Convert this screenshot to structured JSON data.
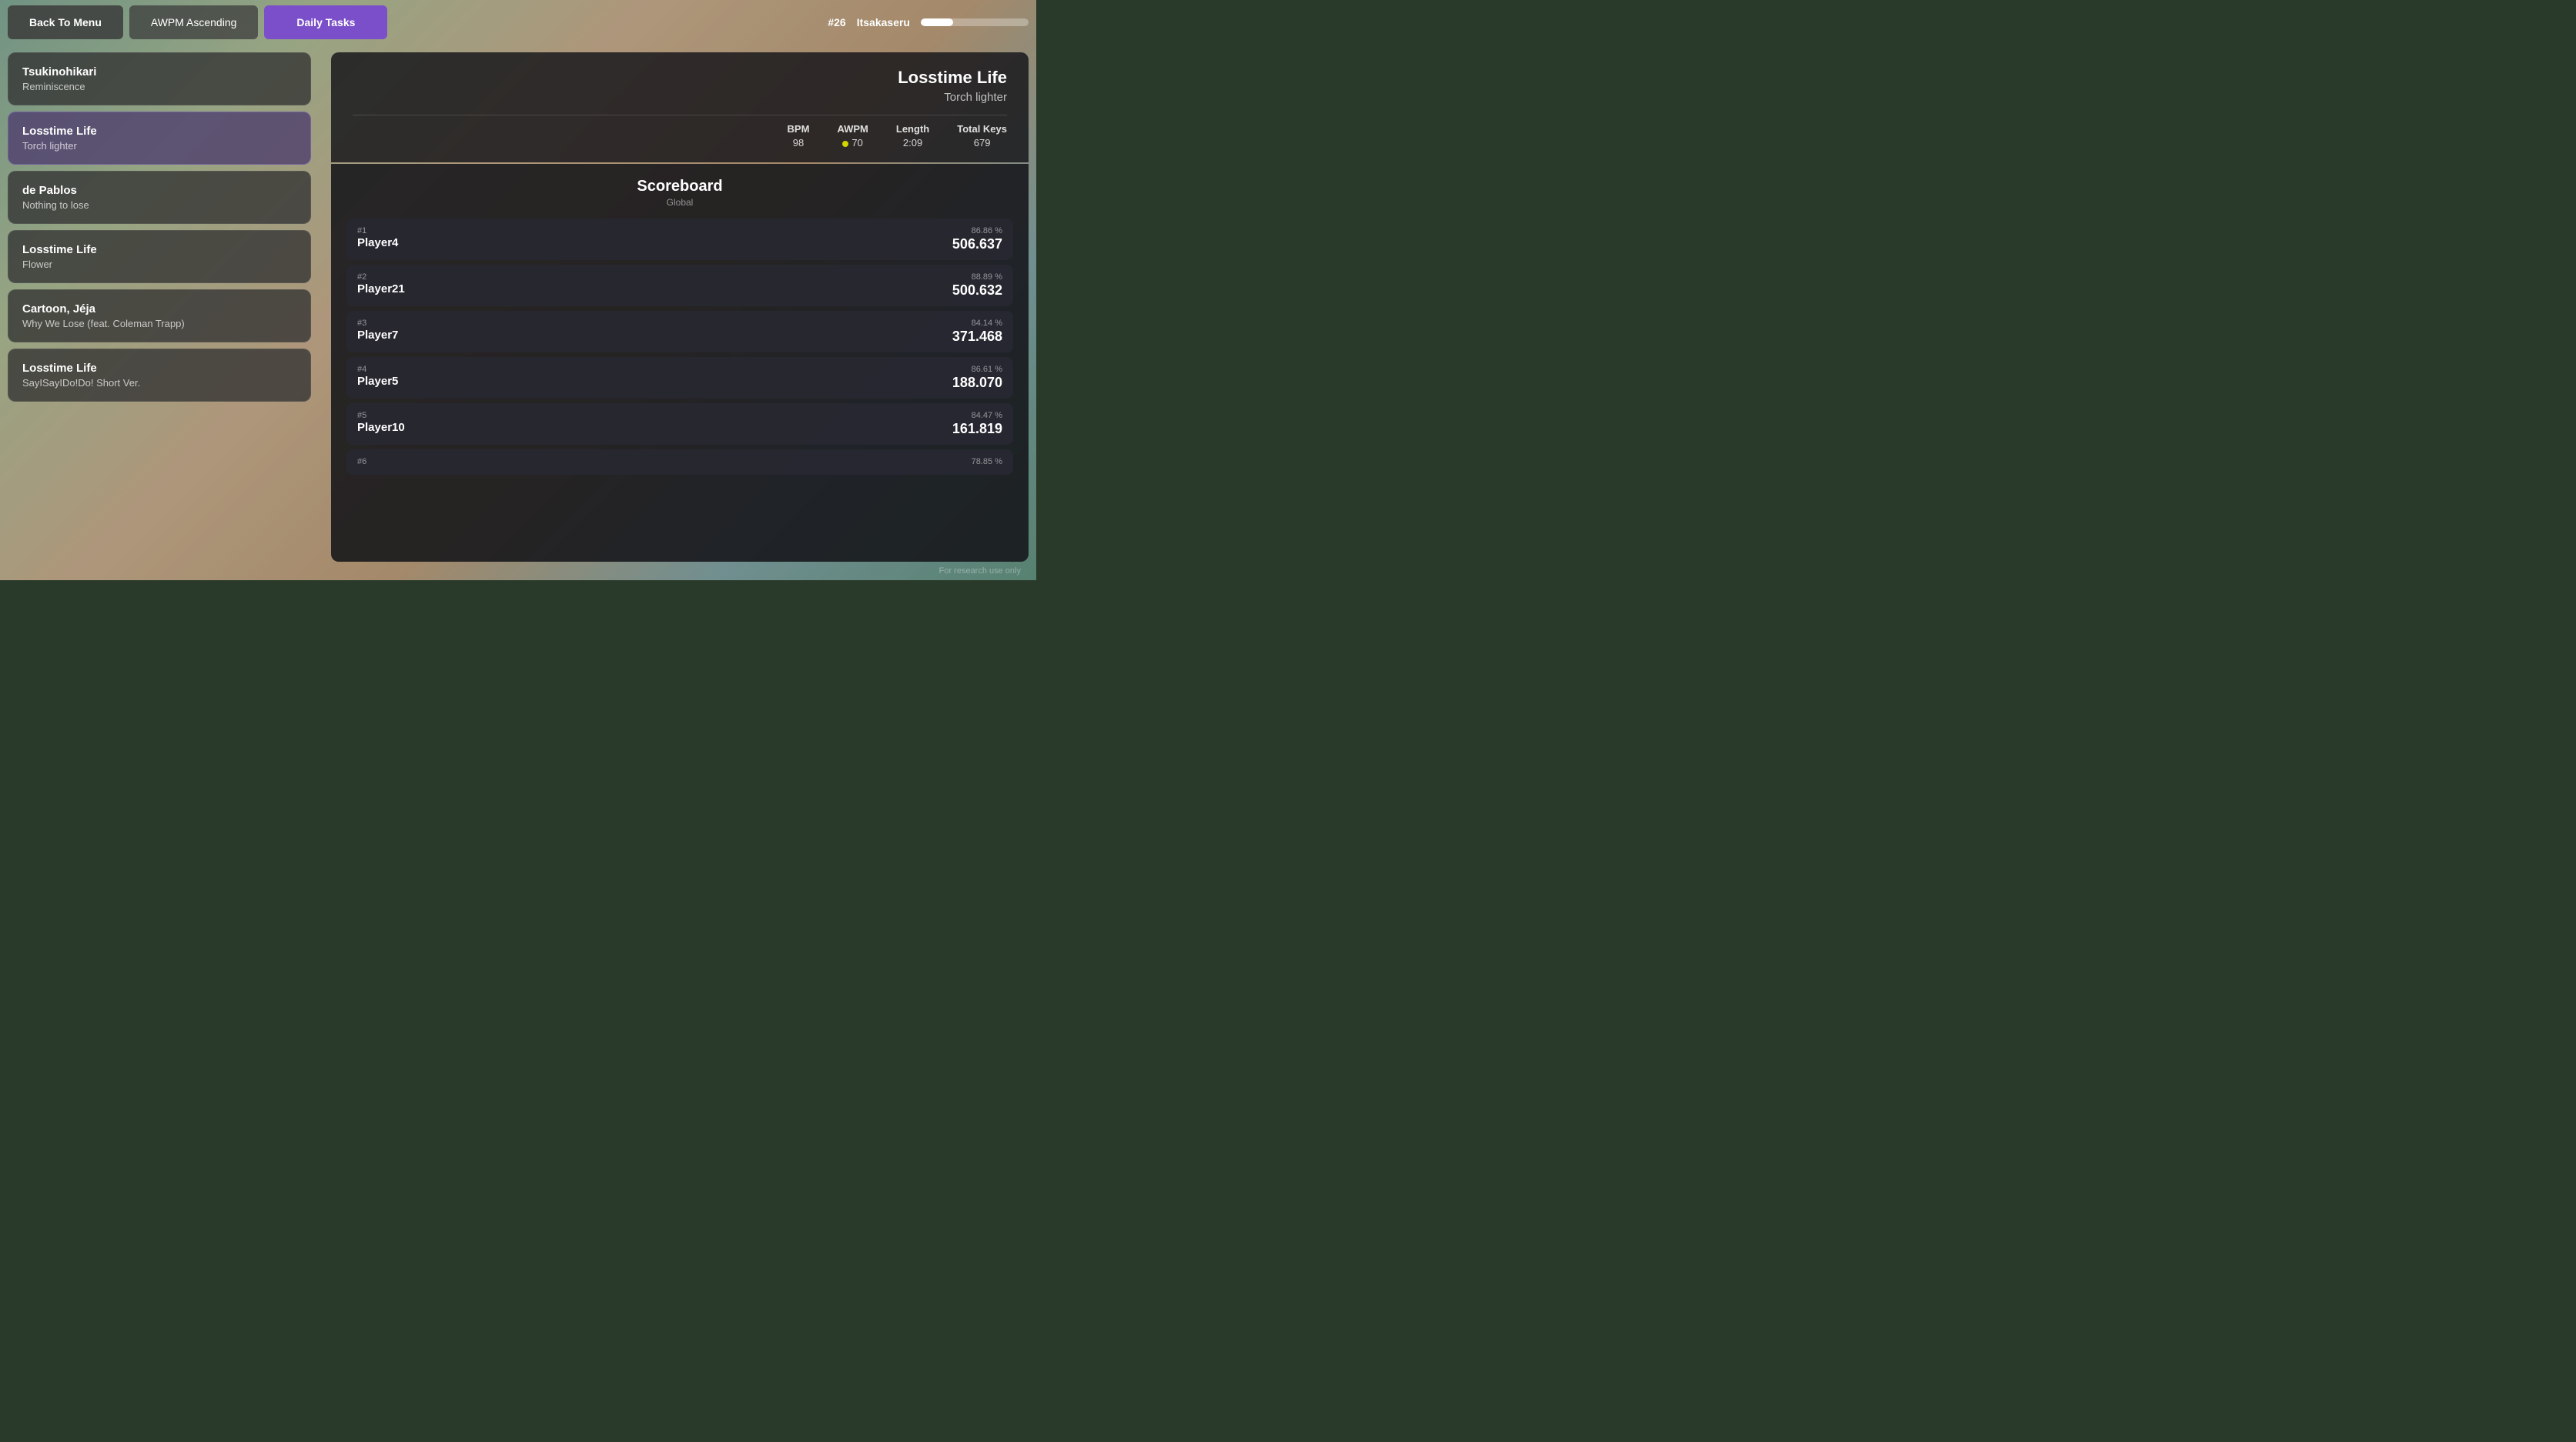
{
  "topbar": {
    "back_label": "Back To Menu",
    "awpm_label": "AWPM Ascending",
    "daily_label": "Daily Tasks",
    "rank_prefix": "#",
    "rank_number": "26",
    "username": "Itsakaseru",
    "xp_percent": 30
  },
  "songs": [
    {
      "id": 1,
      "title": "Tsukinohikari",
      "artist": "Reminiscence"
    },
    {
      "id": 2,
      "title": "Losstime Life",
      "artist": "Torch lighter",
      "selected": true
    },
    {
      "id": 3,
      "title": "de Pablos",
      "artist": "Nothing to lose"
    },
    {
      "id": 4,
      "title": "Losstime Life",
      "artist": "Flower"
    },
    {
      "id": 5,
      "title": "Cartoon, Jéja",
      "artist": "Why We Lose (feat. Coleman Trapp)"
    },
    {
      "id": 6,
      "title": "Losstime Life",
      "artist": "SayISayIDo!Do! Short Ver."
    }
  ],
  "selected_song": {
    "title": "Losstime Life",
    "artist": "Torch lighter",
    "bpm_label": "BPM",
    "bpm_value": "98",
    "awpm_label": "AWPM",
    "awpm_value": "70",
    "length_label": "Length",
    "length_value": "2:09",
    "keys_label": "Total Keys",
    "keys_value": "679"
  },
  "scoreboard": {
    "title": "Scoreboard",
    "subtitle": "Global",
    "entries": [
      {
        "rank": "#1",
        "player": "Player4",
        "pct": "86.86 %",
        "score": "506.637"
      },
      {
        "rank": "#2",
        "player": "Player21",
        "pct": "88.89 %",
        "score": "500.632"
      },
      {
        "rank": "#3",
        "player": "Player7",
        "pct": "84.14 %",
        "score": "371.468"
      },
      {
        "rank": "#4",
        "player": "Player5",
        "pct": "86.61 %",
        "score": "188.070"
      },
      {
        "rank": "#5",
        "player": "Player10",
        "pct": "84.47 %",
        "score": "161.819"
      },
      {
        "rank": "#6",
        "player": "",
        "pct": "78.85 %",
        "score": ""
      }
    ]
  },
  "footer": {
    "note": "For research use only"
  }
}
